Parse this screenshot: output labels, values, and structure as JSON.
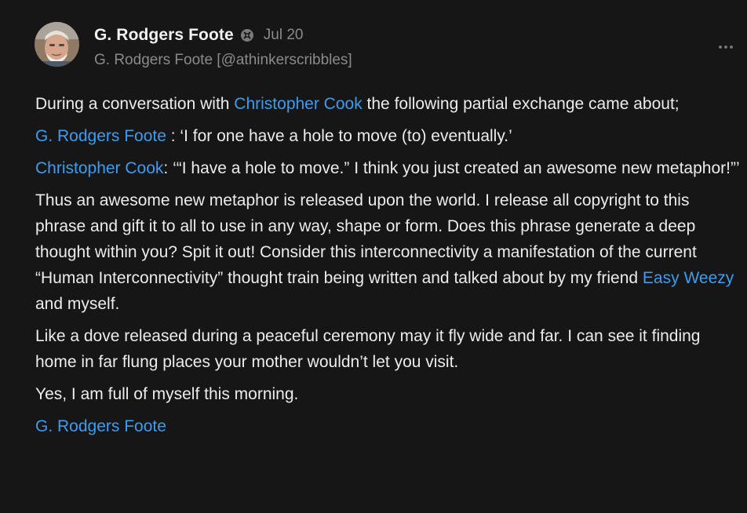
{
  "post": {
    "author": {
      "name": "G. Rodgers Foote",
      "handle_line": "G. Rodgers Foote [@athinkerscribbles]",
      "badge_icon": "verified-badge-icon",
      "avatar": "avatar-photo"
    },
    "date": "Jul 20",
    "more_icon": "ellipsis-icon",
    "colors": {
      "background": "#161616",
      "text": "#ececec",
      "muted": "#8a8a8a",
      "link": "#3d9cf0"
    }
  },
  "body": {
    "p1": {
      "before": "During a conversation with ",
      "link": "Christopher Cook",
      "after": " the following partial exchange came about;"
    },
    "p2": {
      "link": "G. Rodgers Foote",
      "after": " : ‘I for one have a hole to move (to) eventually.’"
    },
    "p3": {
      "link": "Christopher Cook",
      "after": ": ‘“I have a hole to move.” I think you just created an awesome new metaphor!”’"
    },
    "p4": {
      "before": "Thus an awesome new metaphor is released upon the world. I release all copyright to this phrase and gift it to all to use in any way, shape or form. Does this phrase generate a deep thought within you? Spit it out! Consider this interconnectivity a manifestation of the current “Human Interconnectivity” thought train being written and talked about by my friend ",
      "link": "Easy Weezy",
      "after": " and myself."
    },
    "p5": "Like a dove released during a peaceful ceremony may it fly wide and far. I can see it finding home in far flung places your mother wouldn’t let you visit.",
    "p6": "Yes, I am full of myself this morning.",
    "signature": "G. Rodgers Foote"
  }
}
